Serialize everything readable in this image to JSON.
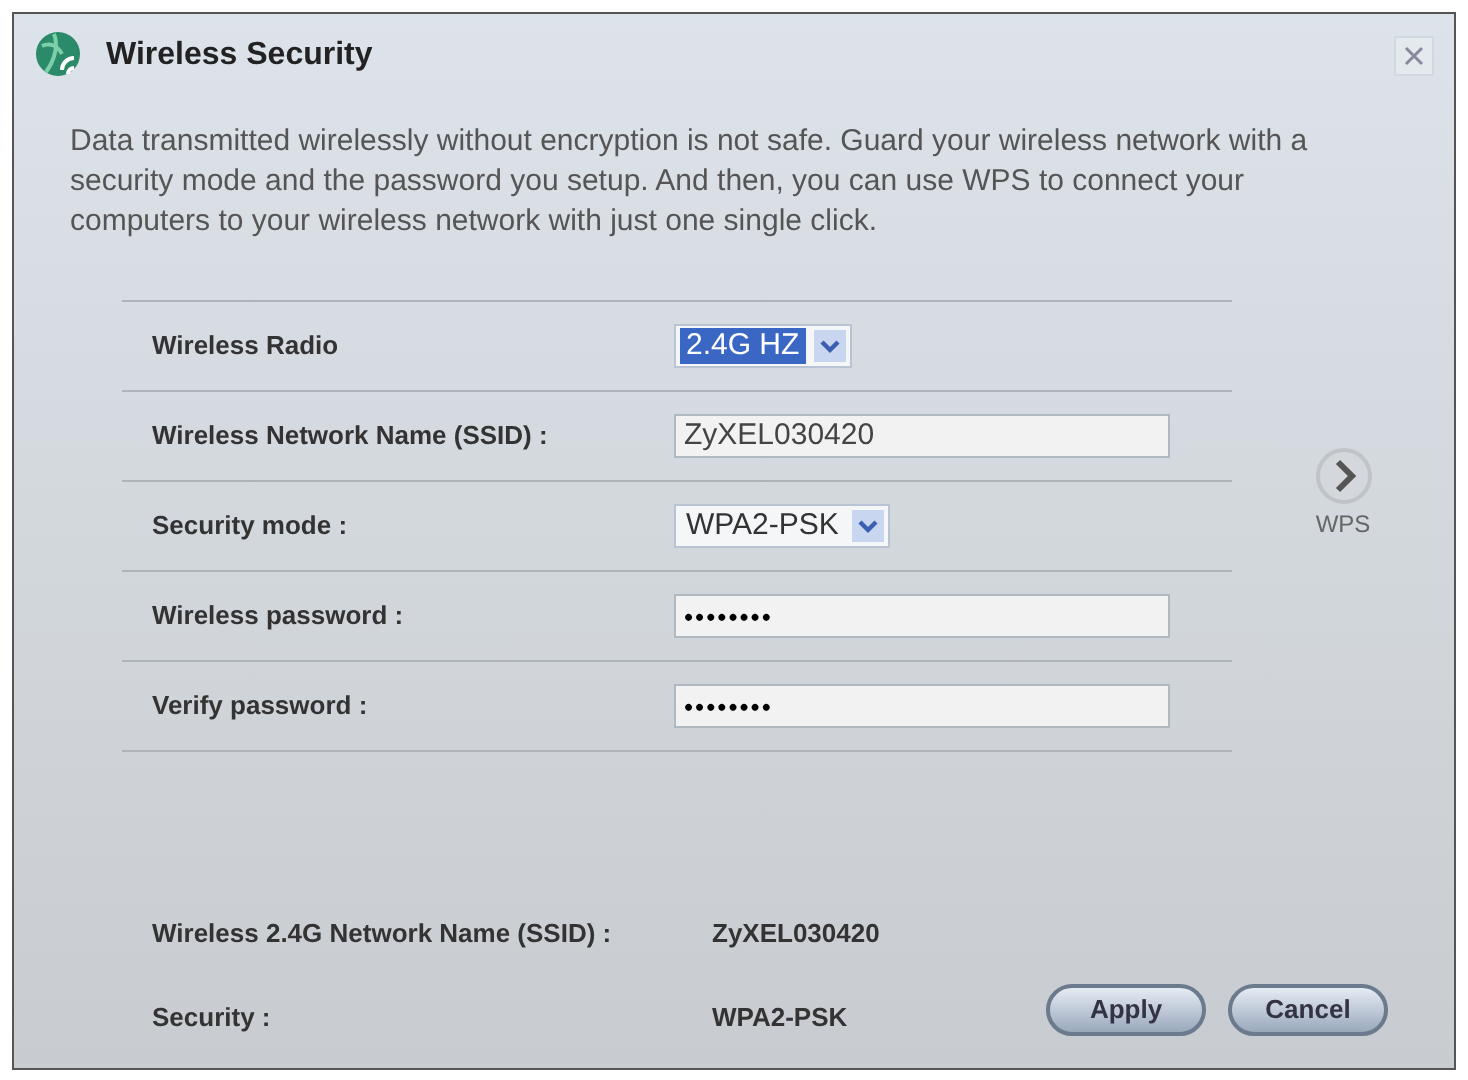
{
  "window": {
    "title": "Wireless Security"
  },
  "description": "Data transmitted wirelessly without encryption is not safe. Guard your wireless network with a security mode and the password you setup. And then, you can use WPS to connect your computers to your wireless network with just one single click.",
  "fields": [
    {
      "kind": "select",
      "label": "Wireless Radio",
      "value": "2.4G HZ",
      "focused": true
    },
    {
      "kind": "text",
      "label": "Wireless Network Name (SSID) :",
      "value": "ZyXEL030420"
    },
    {
      "kind": "select",
      "label": "Security mode :",
      "value": "WPA2-PSK",
      "focused": false
    },
    {
      "kind": "password",
      "label": "Wireless password :",
      "value": "••••••••"
    },
    {
      "kind": "password",
      "label": "Verify password :",
      "value": "••••••••"
    }
  ],
  "wps": {
    "label": "WPS"
  },
  "summary": [
    {
      "label": "Wireless 2.4G Network Name (SSID) :",
      "value": "ZyXEL030420"
    },
    {
      "label": "Security :",
      "value": "WPA2-PSK"
    }
  ],
  "buttons": [
    "Apply",
    "Cancel"
  ]
}
